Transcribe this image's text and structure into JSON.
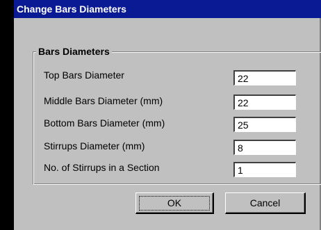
{
  "window": {
    "title": "Change Bars Diameters"
  },
  "group": {
    "legend": "Bars Diameters"
  },
  "fields": [
    {
      "label": "Top Bars Diameter",
      "value": "22"
    },
    {
      "label": "Middle Bars Diameter (mm)",
      "value": "22"
    },
    {
      "label": "Bottom Bars Diameter (mm)",
      "value": "25"
    },
    {
      "label": "Stirrups Diameter (mm)",
      "value": "8"
    },
    {
      "label": "No. of Stirrups in a Section",
      "value": "1"
    }
  ],
  "buttons": {
    "ok_label": "OK",
    "cancel_label": "Cancel"
  },
  "colors": {
    "titlebar": "#0a1a94",
    "dialog_face": "#c0c0c0"
  }
}
